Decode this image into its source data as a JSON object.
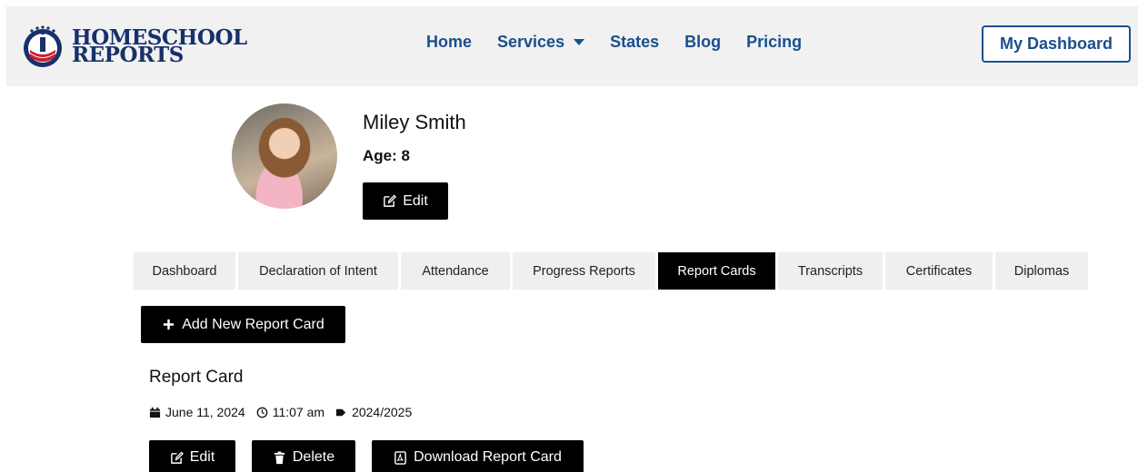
{
  "brand": {
    "line1": "HOMESCHOOL",
    "line2": "REPORTS"
  },
  "nav": {
    "items": [
      {
        "label": "Home"
      },
      {
        "label": "Services"
      },
      {
        "label": "States"
      },
      {
        "label": "Blog"
      },
      {
        "label": "Pricing"
      }
    ],
    "dashboard_label": "My Dashboard"
  },
  "profile": {
    "name": "Miley Smith",
    "age": "Age: 8",
    "edit_label": "Edit"
  },
  "tabs": [
    {
      "label": "Dashboard",
      "active": false
    },
    {
      "label": "Declaration of Intent",
      "active": false
    },
    {
      "label": "Attendance",
      "active": false
    },
    {
      "label": "Progress Reports",
      "active": false
    },
    {
      "label": "Report Cards",
      "active": true
    },
    {
      "label": "Transcripts",
      "active": false
    },
    {
      "label": "Certificates",
      "active": false
    },
    {
      "label": "Diplomas",
      "active": false
    }
  ],
  "add_button_label": "Add New Report Card",
  "report_card": {
    "title": "Report Card",
    "date": "June 11, 2024",
    "time": "11:07 am",
    "tag": "2024/2025",
    "edit_label": "Edit",
    "delete_label": "Delete",
    "download_label": "Download Report Card"
  },
  "colors": {
    "brand_navy": "#17306b",
    "nav_blue": "#1a4f8c",
    "accent_red": "#c8202f",
    "header_bg": "#f1f1f1"
  }
}
